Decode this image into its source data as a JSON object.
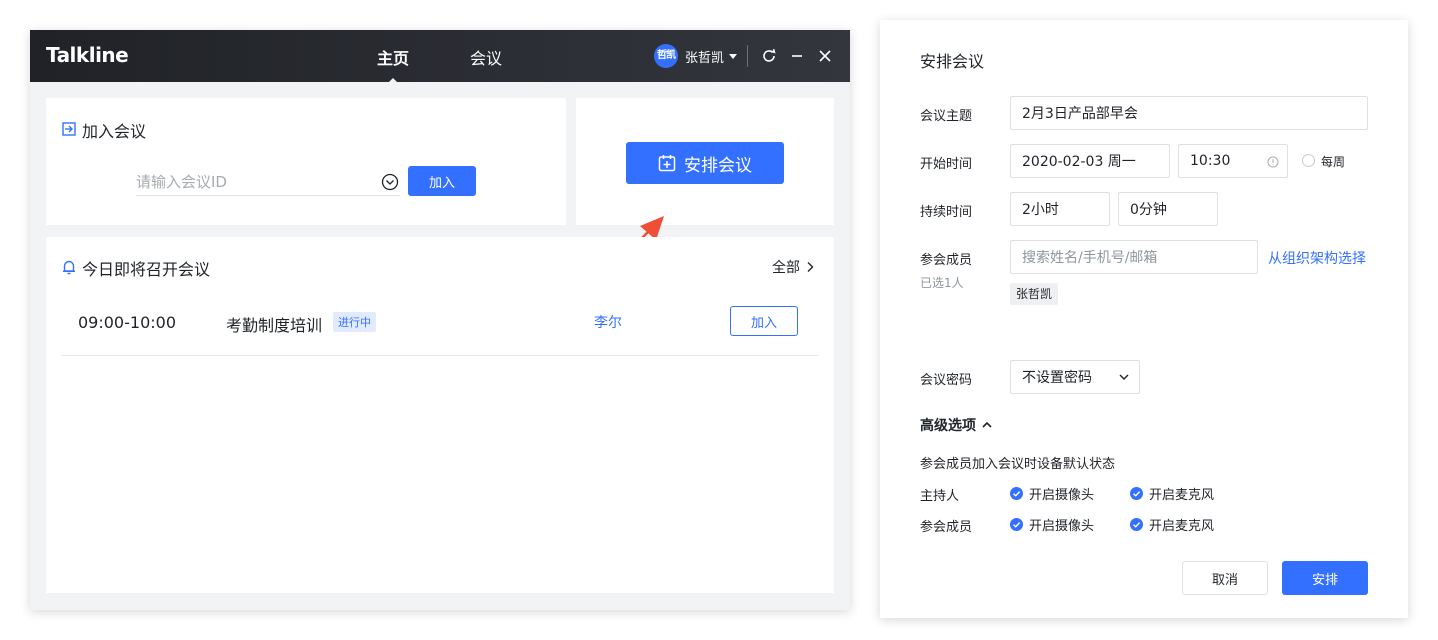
{
  "app": {
    "logo": "Talkline",
    "nav_tabs": [
      {
        "label": "主页",
        "active": true
      },
      {
        "label": "会议",
        "active": false
      }
    ],
    "user": {
      "avatar_text": "哲凯",
      "name": "张哲凯"
    }
  },
  "join_card": {
    "title": "加入会议",
    "input_placeholder": "请输入会议ID",
    "join_label": "加入"
  },
  "schedule_card": {
    "button_label": "安排会议"
  },
  "upcoming": {
    "title": "今日即将召开会议",
    "view_all": "全部",
    "meetings": [
      {
        "time": "09:00-10:00",
        "title": "考勤制度培训",
        "status": "进行中",
        "host": "李尔",
        "join_label": "加入"
      }
    ]
  },
  "dialog": {
    "title": "安排会议",
    "subject_label": "会议主题",
    "subject_value": "2月3日产品部早会",
    "start_label": "开始时间",
    "start_date": "2020-02-03  周一",
    "start_time": "10:30",
    "weekly_label": "每周",
    "duration_label": "持续时间",
    "duration_hours": "2小时",
    "duration_minutes": "0分钟",
    "members_label": "参会成员",
    "members_selected_hint": "已选1人",
    "members_placeholder": "搜索姓名/手机号/邮箱",
    "org_link": "从组织架构选择",
    "member_tags": [
      "张哲凯"
    ],
    "password_label": "会议密码",
    "password_value": "不设置密码",
    "advanced_title": "高级选项",
    "advanced_desc": "参会成员加入会议时设备默认状态",
    "host_label": "主持人",
    "attendee_label": "参会成员",
    "camera_label": "开启摄像头",
    "mic_label": "开启麦克风",
    "cancel_label": "取消",
    "submit_label": "安排"
  },
  "colors": {
    "accent": "#3370ff",
    "titlebar": "#2b2d33",
    "annotation_arrow": "#f04e37"
  }
}
